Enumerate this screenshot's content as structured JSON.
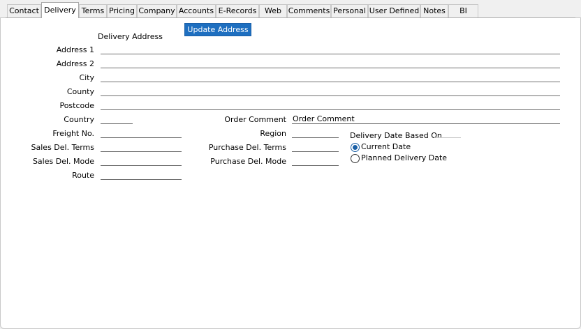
{
  "tabs": [
    {
      "key": "contact",
      "label": "Contact"
    },
    {
      "key": "delivery",
      "label": "Delivery"
    },
    {
      "key": "terms",
      "label": "Terms"
    },
    {
      "key": "pricing",
      "label": "Pricing"
    },
    {
      "key": "company",
      "label": "Company"
    },
    {
      "key": "accounts",
      "label": "Accounts"
    },
    {
      "key": "erecords",
      "label": "E-Records"
    },
    {
      "key": "web",
      "label": "Web"
    },
    {
      "key": "comments",
      "label": "Comments"
    },
    {
      "key": "personal",
      "label": "Personal"
    },
    {
      "key": "userdefined",
      "label": "User Defined"
    },
    {
      "key": "notes",
      "label": "Notes"
    },
    {
      "key": "bi",
      "label": "BI"
    }
  ],
  "active_tab": "Delivery",
  "delivery_address": {
    "header": "Delivery Address",
    "update_button": "Update Address",
    "address1_label": "Address 1",
    "address1_value": "",
    "address2_label": "Address 2",
    "address2_value": "",
    "city_label": "City",
    "city_value": "",
    "county_label": "County",
    "county_value": "",
    "postcode_label": "Postcode",
    "postcode_value": "",
    "country_label": "Country",
    "country_value": ""
  },
  "left_fields": {
    "freight_no_label": "Freight No.",
    "freight_no_value": "",
    "sales_del_terms_label": "Sales Del. Terms",
    "sales_del_terms_value": "",
    "sales_del_mode_label": "Sales Del. Mode",
    "sales_del_mode_value": "",
    "route_label": "Route",
    "route_value": ""
  },
  "middle_fields": {
    "order_comment_label": "Order Comment",
    "order_comment_value": "Order Comment",
    "region_label": "Region",
    "region_value": "",
    "purchase_del_terms_label": "Purchase Del. Terms",
    "purchase_del_terms_value": "",
    "purchase_del_mode_label": "Purchase Del. Mode",
    "purchase_del_mode_value": ""
  },
  "delivery_date": {
    "group_label": "Delivery Date Based On",
    "options": [
      {
        "label": "Current Date",
        "checked": true
      },
      {
        "label": "Planned Delivery Date",
        "checked": false
      }
    ]
  },
  "colors": {
    "accent": "#1e6fc0",
    "panel_bg": "#ffffff",
    "window_bg": "#f0f0f0"
  }
}
